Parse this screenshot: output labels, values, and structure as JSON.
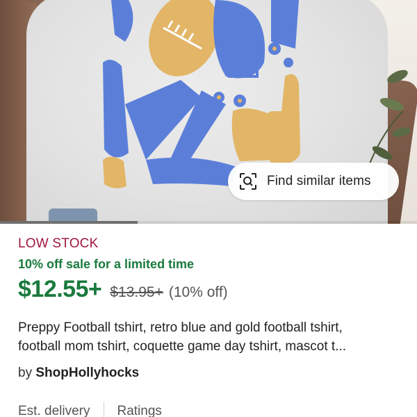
{
  "hero": {
    "find_similar_label": "Find similar items",
    "carousel_progress": 0.33,
    "print_colors": {
      "blue": "#5b7fd9",
      "gold": "#e2b567"
    }
  },
  "listing": {
    "stock_status": "LOW STOCK",
    "sale_text": "10% off sale for a limited time",
    "price": "$12.55+",
    "original_price": "$13.95+",
    "discount": "(10% off)",
    "title_line1": "Preppy Football tshirt, retro blue and gold football tshirt,",
    "title_line2": "football mom tshirt, coquette game day tshirt, mascot t...",
    "by_label": "by",
    "shop_name": "ShopHollyhocks"
  },
  "tabs": [
    {
      "label": "Est. delivery"
    },
    {
      "label": "Ratings"
    }
  ],
  "colors": {
    "low_stock": "#a0163b",
    "sale_green": "#1a7a3d"
  }
}
